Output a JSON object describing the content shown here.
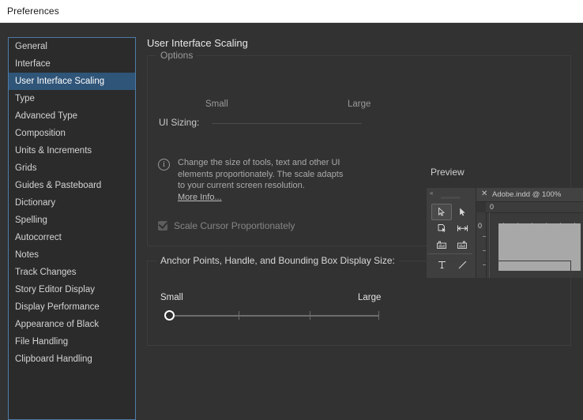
{
  "window": {
    "title": "Preferences"
  },
  "sidebar": {
    "items": [
      {
        "label": "General",
        "selected": false
      },
      {
        "label": "Interface",
        "selected": false
      },
      {
        "label": "User Interface Scaling",
        "selected": true
      },
      {
        "label": "Type",
        "selected": false
      },
      {
        "label": "Advanced Type",
        "selected": false
      },
      {
        "label": "Composition",
        "selected": false
      },
      {
        "label": "Units & Increments",
        "selected": false
      },
      {
        "label": "Grids",
        "selected": false
      },
      {
        "label": "Guides & Pasteboard",
        "selected": false
      },
      {
        "label": "Dictionary",
        "selected": false
      },
      {
        "label": "Spelling",
        "selected": false
      },
      {
        "label": "Autocorrect",
        "selected": false
      },
      {
        "label": "Notes",
        "selected": false
      },
      {
        "label": "Track Changes",
        "selected": false
      },
      {
        "label": "Story Editor Display",
        "selected": false
      },
      {
        "label": "Display Performance",
        "selected": false
      },
      {
        "label": "Appearance of Black",
        "selected": false
      },
      {
        "label": "File Handling",
        "selected": false
      },
      {
        "label": "Clipboard Handling",
        "selected": false
      }
    ]
  },
  "main": {
    "page_title": "User Interface Scaling",
    "options_group": {
      "legend": "Options",
      "ui_sizing": {
        "row_label": "UI Sizing:",
        "small_label": "Small",
        "large_label": "Large",
        "disabled": true
      },
      "info": {
        "icon": "info-circle-icon",
        "glyph": "i",
        "text": "Change the size of tools, text and other UI elements proportionately. The scale adapts to your current screen resolution.",
        "link_label": "More Info..."
      },
      "scale_cursor_checkbox": {
        "label": "Scale Cursor Proportionately",
        "checked": true,
        "disabled": true
      },
      "preview": {
        "title": "Preview",
        "collapse_glyph": "«",
        "close_glyph": "✕",
        "tab_label": "Adobe.indd @ 100%",
        "ruler_origin_h": "0",
        "ruler_origin_v": "0"
      }
    },
    "anchor_group": {
      "legend": "Anchor Points, Handle, and Bounding Box Display Size:",
      "small_label": "Small",
      "large_label": "Large",
      "value_position_percent": 0
    }
  },
  "colors": {
    "window_background": "#323232",
    "titlebar_background": "#ffffff",
    "sidebar_background": "#2b2b2b",
    "sidebar_border": "#4f7ca8",
    "selection": "#2f5578",
    "text_primary": "#d4d4d4",
    "text_dim": "#9a9a9a",
    "page_white": "#a8a8a8"
  }
}
